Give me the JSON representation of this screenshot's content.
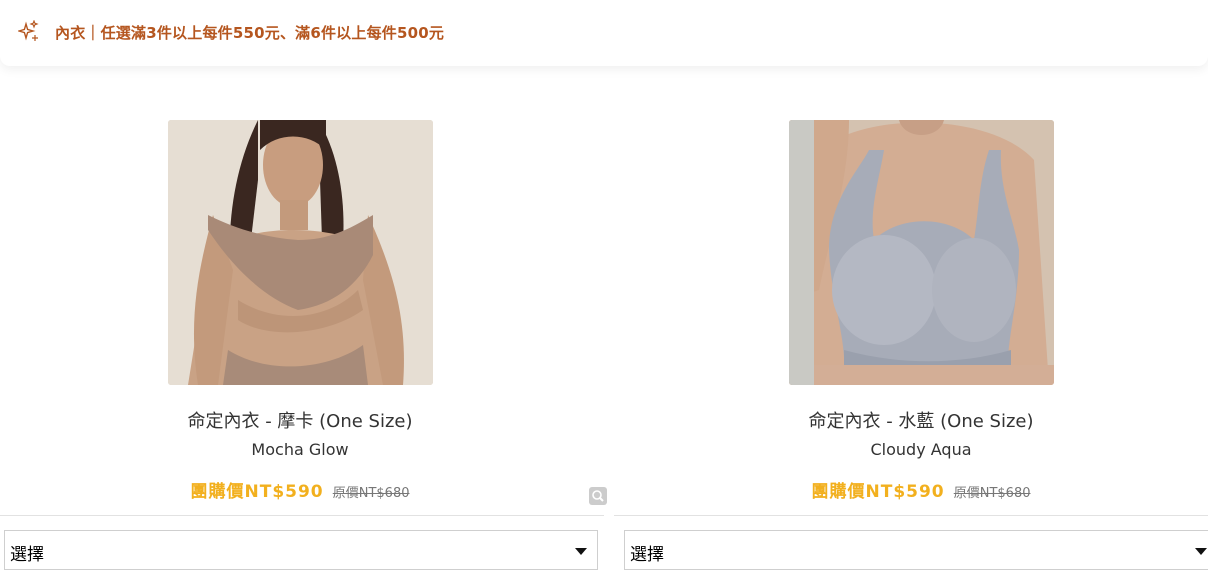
{
  "promo": {
    "icon": "sparkle-icon",
    "text": "內衣｜任選滿3件以上每件550元、滿6件以上每件500元",
    "color": "#b5561f"
  },
  "products": [
    {
      "name": "命定內衣 - 摩卡 (One Size)",
      "subtitle": "Mocha Glow",
      "price": "團購價NT$590",
      "original_price": "原價NT$680",
      "select_label": "選擇",
      "image_alt": "model wearing mocha bra"
    },
    {
      "name": "命定內衣 - 水藍 (One Size)",
      "subtitle": "Cloudy Aqua",
      "price": "團購價NT$590",
      "original_price": "原價NT$680",
      "select_label": "選擇",
      "image_alt": "model wearing aqua bra"
    }
  ],
  "icons": {
    "zoom": "magnifier-icon",
    "dropdown": "caret-down-icon"
  },
  "colors": {
    "price": "#f2b01e",
    "promo": "#b5561f"
  }
}
